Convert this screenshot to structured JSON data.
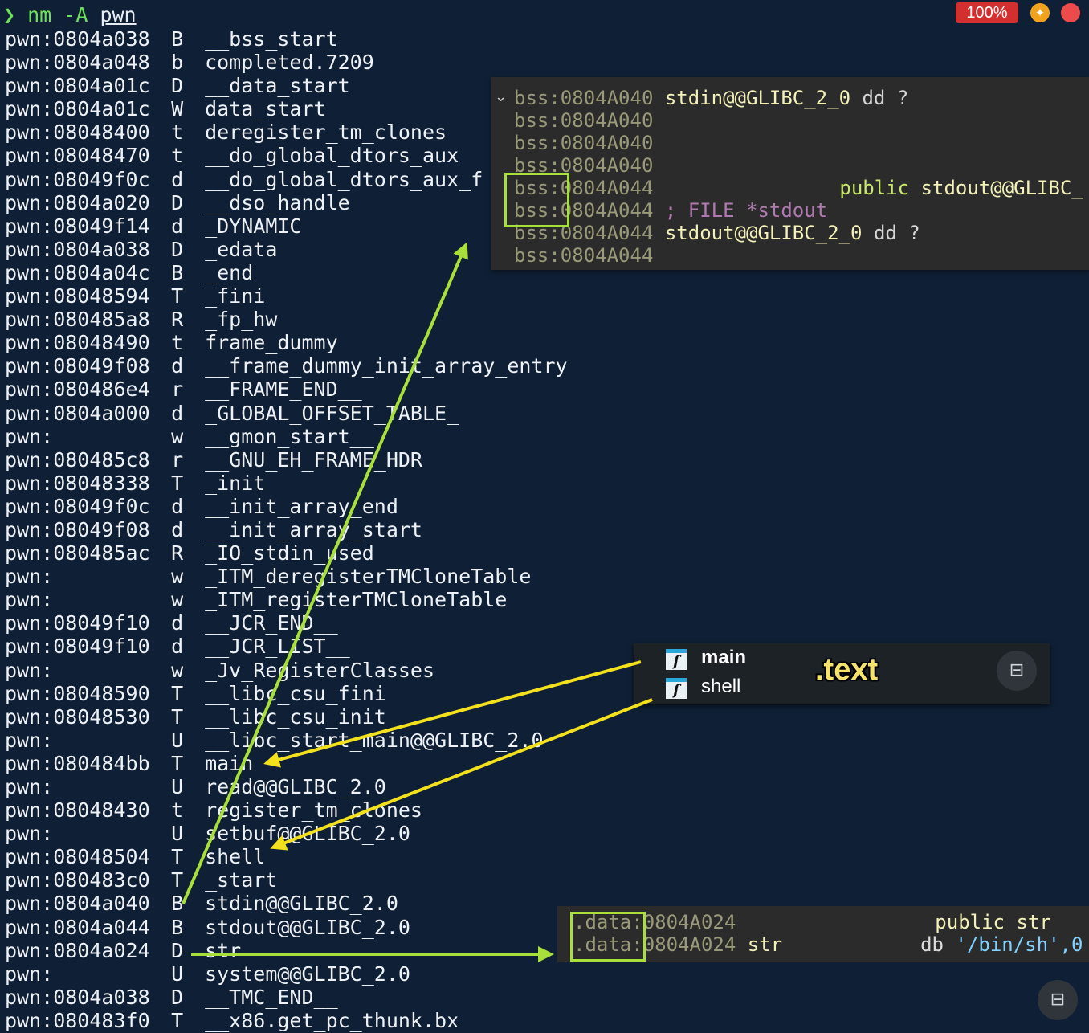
{
  "terminal": {
    "prompt_symbol": "❯",
    "command": "nm -A",
    "argument": "pwn",
    "lines": [
      {
        "prefix": "pwn:0804a038",
        "type": "B",
        "symbol": "__bss_start"
      },
      {
        "prefix": "pwn:0804a048",
        "type": "b",
        "symbol": "completed.7209"
      },
      {
        "prefix": "pwn:0804a01c",
        "type": "D",
        "symbol": "__data_start"
      },
      {
        "prefix": "pwn:0804a01c",
        "type": "W",
        "symbol": "data_start"
      },
      {
        "prefix": "pwn:08048400",
        "type": "t",
        "symbol": "deregister_tm_clones"
      },
      {
        "prefix": "pwn:08048470",
        "type": "t",
        "symbol": "__do_global_dtors_aux"
      },
      {
        "prefix": "pwn:08049f0c",
        "type": "d",
        "symbol": "__do_global_dtors_aux_f"
      },
      {
        "prefix": "pwn:0804a020",
        "type": "D",
        "symbol": "__dso_handle"
      },
      {
        "prefix": "pwn:08049f14",
        "type": "d",
        "symbol": "_DYNAMIC"
      },
      {
        "prefix": "pwn:0804a038",
        "type": "D",
        "symbol": "_edata"
      },
      {
        "prefix": "pwn:0804a04c",
        "type": "B",
        "symbol": "_end"
      },
      {
        "prefix": "pwn:08048594",
        "type": "T",
        "symbol": "_fini"
      },
      {
        "prefix": "pwn:080485a8",
        "type": "R",
        "symbol": "_fp_hw"
      },
      {
        "prefix": "pwn:08048490",
        "type": "t",
        "symbol": "frame_dummy"
      },
      {
        "prefix": "pwn:08049f08",
        "type": "d",
        "symbol": "__frame_dummy_init_array_entry"
      },
      {
        "prefix": "pwn:080486e4",
        "type": "r",
        "symbol": "__FRAME_END__"
      },
      {
        "prefix": "pwn:0804a000",
        "type": "d",
        "symbol": "_GLOBAL_OFFSET_TABLE_"
      },
      {
        "prefix": "pwn:",
        "type": "w",
        "symbol": "__gmon_start__"
      },
      {
        "prefix": "pwn:080485c8",
        "type": "r",
        "symbol": "__GNU_EH_FRAME_HDR"
      },
      {
        "prefix": "pwn:08048338",
        "type": "T",
        "symbol": "_init"
      },
      {
        "prefix": "pwn:08049f0c",
        "type": "d",
        "symbol": "__init_array_end"
      },
      {
        "prefix": "pwn:08049f08",
        "type": "d",
        "symbol": "__init_array_start"
      },
      {
        "prefix": "pwn:080485ac",
        "type": "R",
        "symbol": "_IO_stdin_used"
      },
      {
        "prefix": "pwn:",
        "type": "w",
        "symbol": "_ITM_deregisterTMCloneTable"
      },
      {
        "prefix": "pwn:",
        "type": "w",
        "symbol": "_ITM_registerTMCloneTable"
      },
      {
        "prefix": "pwn:08049f10",
        "type": "d",
        "symbol": "__JCR_END__"
      },
      {
        "prefix": "pwn:08049f10",
        "type": "d",
        "symbol": "__JCR_LIST__"
      },
      {
        "prefix": "pwn:",
        "type": "w",
        "symbol": "_Jv_RegisterClasses"
      },
      {
        "prefix": "pwn:08048590",
        "type": "T",
        "symbol": "__libc_csu_fini"
      },
      {
        "prefix": "pwn:08048530",
        "type": "T",
        "symbol": "__libc_csu_init"
      },
      {
        "prefix": "pwn:",
        "type": "U",
        "symbol": "__libc_start_main@@GLIBC_2.0"
      },
      {
        "prefix": "pwn:080484bb",
        "type": "T",
        "symbol": "main"
      },
      {
        "prefix": "pwn:",
        "type": "U",
        "symbol": "read@@GLIBC_2.0"
      },
      {
        "prefix": "pwn:08048430",
        "type": "t",
        "symbol": "register_tm_clones"
      },
      {
        "prefix": "pwn:",
        "type": "U",
        "symbol": "setbuf@@GLIBC_2.0"
      },
      {
        "prefix": "pwn:08048504",
        "type": "T",
        "symbol": "shell"
      },
      {
        "prefix": "pwn:080483c0",
        "type": "T",
        "symbol": "_start"
      },
      {
        "prefix": "pwn:0804a040",
        "type": "B",
        "symbol": "stdin@@GLIBC_2.0"
      },
      {
        "prefix": "pwn:0804a044",
        "type": "B",
        "symbol": "stdout@@GLIBC_2.0"
      },
      {
        "prefix": "pwn:0804a024",
        "type": "D",
        "symbol": "str"
      },
      {
        "prefix": "pwn:",
        "type": "U",
        "symbol": "system@@GLIBC_2.0"
      },
      {
        "prefix": "pwn:0804a038",
        "type": "D",
        "symbol": "__TMC_END__"
      },
      {
        "prefix": "pwn:080483f0",
        "type": "T",
        "symbol": "__x86.get_pc_thunk.bx"
      }
    ]
  },
  "status": {
    "zoom": "100%",
    "pin_icon": "pin-icon",
    "record_icon": "record-icon"
  },
  "bss_panel": {
    "collapse_icon": "chevron-down",
    "rows": [
      {
        "addr": "bss:0804A040",
        "name": "stdin@@GLIBC_2_0",
        "op": "dd ?"
      },
      {
        "addr": "bss:0804A040"
      },
      {
        "addr": "bss:0804A040"
      },
      {
        "addr": "bss:0804A040"
      },
      {
        "addr": "bss:0804A044",
        "public": "public",
        "public_name": "stdout@@GLIBC_"
      },
      {
        "addr": "bss:0804A044",
        "comment": "; FILE *stdout"
      },
      {
        "addr": "bss:0804A044",
        "name": "stdout@@GLIBC_2_0",
        "op": "dd ?"
      },
      {
        "addr": "bss:0804A044"
      }
    ]
  },
  "functions_panel": {
    "items": [
      {
        "icon": "f",
        "label": "main"
      },
      {
        "icon": "f",
        "label": "shell"
      }
    ],
    "section_label": ".text"
  },
  "data_panel": {
    "rows": [
      {
        "seg": ".data:",
        "addr": "0804A024",
        "public": "public",
        "public_name": "str"
      },
      {
        "seg": ".data:",
        "addr": "0804A024",
        "name": "str",
        "db": "db",
        "value": "'/bin/sh',0"
      }
    ]
  },
  "colors": {
    "background": "#0f1f35",
    "green_arrow": "#a9df3a",
    "yellow_arrow": "#f4e11d",
    "badge": "#d32f2f"
  }
}
